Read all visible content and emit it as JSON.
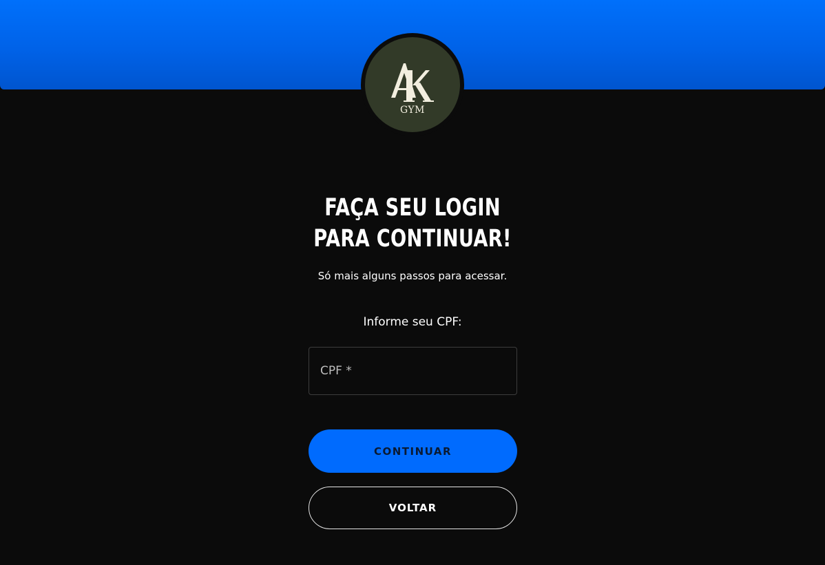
{
  "logo": {
    "initials": "AK",
    "subtitle": "GYM"
  },
  "heading": {
    "line1": "FAÇA SEU LOGIN",
    "line2": "PARA CONTINUAR!"
  },
  "subtitle": "Só mais alguns passos para acessar.",
  "form": {
    "cpf_label": "Informe seu CPF:",
    "cpf_placeholder": "CPF *",
    "cpf_value": ""
  },
  "buttons": {
    "continue_label": "CONTINUAR",
    "back_label": "VOLTAR"
  },
  "colors": {
    "background": "#0b0b0b",
    "banner": "#0066f5",
    "accent": "#006bfe",
    "logo_background": "#323a28"
  }
}
